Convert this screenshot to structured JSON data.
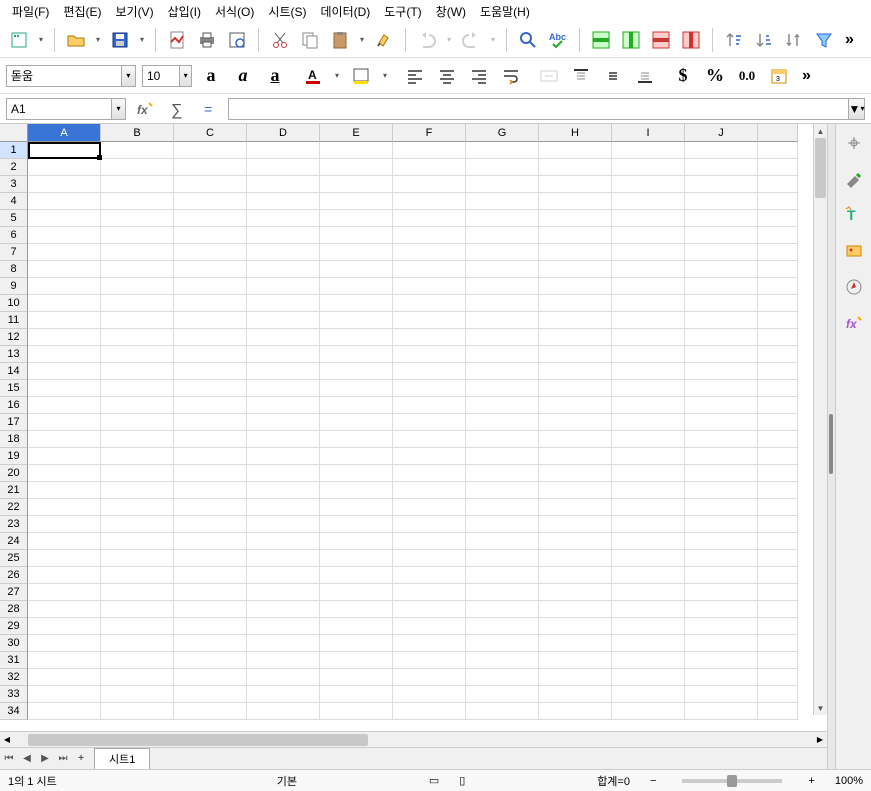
{
  "menu": {
    "file": "파일(F)",
    "edit": "편집(E)",
    "view": "보기(V)",
    "insert": "삽입(I)",
    "format": "서식(O)",
    "sheet": "시트(S)",
    "data": "데이터(D)",
    "tools": "도구(T)",
    "window": "창(W)",
    "help": "도움말(H)"
  },
  "font": {
    "name": "돋움",
    "size": "10"
  },
  "cellref": "A1",
  "formula_input": "",
  "columns": [
    "A",
    "B",
    "C",
    "D",
    "E",
    "F",
    "G",
    "H",
    "I",
    "J"
  ],
  "rows": [
    "1",
    "2",
    "3",
    "4",
    "5",
    "6",
    "7",
    "8",
    "9",
    "10",
    "11",
    "12",
    "13",
    "14",
    "15",
    "16",
    "17",
    "18",
    "19",
    "20",
    "21",
    "22",
    "23",
    "24",
    "25",
    "26",
    "27",
    "28",
    "29",
    "30",
    "31",
    "32",
    "33",
    "34"
  ],
  "sheet_tab": "시트1",
  "status": {
    "sheet_count": "1의 1 시트",
    "style": "기본",
    "sum": "합계=0",
    "zoom": "100%"
  },
  "number_format_label": "0.0",
  "currency_symbol": "$",
  "percent_symbol": "%"
}
